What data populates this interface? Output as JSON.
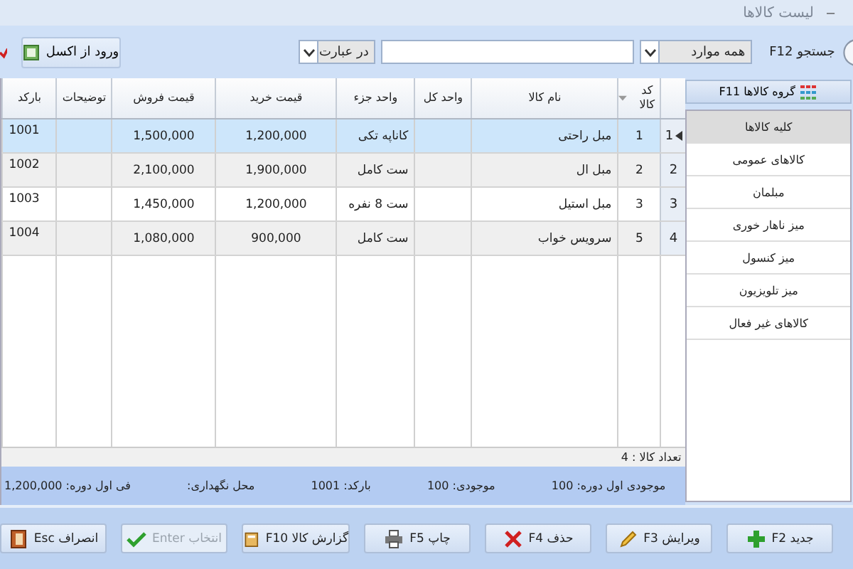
{
  "window": {
    "title": "لیست کالاها",
    "minimize": "–"
  },
  "toolbar": {
    "search_label": "جستجو F12",
    "scope": "همه موارد",
    "match": "در عبارت",
    "import_button": "ورود از اکسل"
  },
  "sidebar": {
    "header": "گروه کالاها F11",
    "items": [
      {
        "label": "کلیه کالاها",
        "selected": true
      },
      {
        "label": "کالاهای عمومی",
        "selected": false
      },
      {
        "label": "مبلمان",
        "selected": false
      },
      {
        "label": "میز ناهار خوری",
        "selected": false
      },
      {
        "label": "میز کنسول",
        "selected": false
      },
      {
        "label": "میز تلویزیون",
        "selected": false
      },
      {
        "label": "کالاهای غیر فعال",
        "selected": false
      }
    ]
  },
  "table": {
    "columns": [
      "کد کالا",
      "نام کالا",
      "واحد کل",
      "واحد جزء",
      "قیمت خرید",
      "قیمت فروش",
      "توضیحات",
      "بارکد"
    ],
    "rows": [
      {
        "index": "1",
        "selected": true,
        "cells": [
          "1",
          "مبل راحتی",
          "",
          "کاناپه تکی",
          "1,200,000",
          "1,500,000",
          "",
          "1001"
        ]
      },
      {
        "index": "2",
        "selected": false,
        "cells": [
          "2",
          "مبل ال",
          "",
          "ست کامل",
          "1,900,000",
          "2,100,000",
          "",
          "1002"
        ]
      },
      {
        "index": "3",
        "selected": false,
        "cells": [
          "3",
          "مبل استیل",
          "",
          "ست 8 نفره",
          "1,200,000",
          "1,450,000",
          "",
          "1003"
        ]
      },
      {
        "index": "4",
        "selected": false,
        "cells": [
          "5",
          "سرویس خواب",
          "",
          "ست کامل",
          "900,000",
          "1,080,000",
          "",
          "1004"
        ]
      }
    ]
  },
  "count": "تعداد کالا : 4",
  "details": [
    "موجودی اول دوره: 100",
    "موجودی: 100",
    "بارکد: 1001",
    "محل نگهداری:",
    "فی اول دوره: 1,200,000"
  ],
  "buttons": [
    {
      "label": "جدید F2",
      "kind": "add",
      "disabled": false
    },
    {
      "label": "ویرایش F3",
      "kind": "edit",
      "disabled": false
    },
    {
      "label": "حذف F4",
      "kind": "delete",
      "disabled": false
    },
    {
      "label": "چاپ F5",
      "kind": "print",
      "disabled": false
    },
    {
      "label": "گزارش کالا F10",
      "kind": "report",
      "disabled": false
    },
    {
      "label": "انتخاب Enter",
      "kind": "select",
      "disabled": true
    },
    {
      "label": "انصراف Esc",
      "kind": "cancel",
      "disabled": false
    }
  ]
}
